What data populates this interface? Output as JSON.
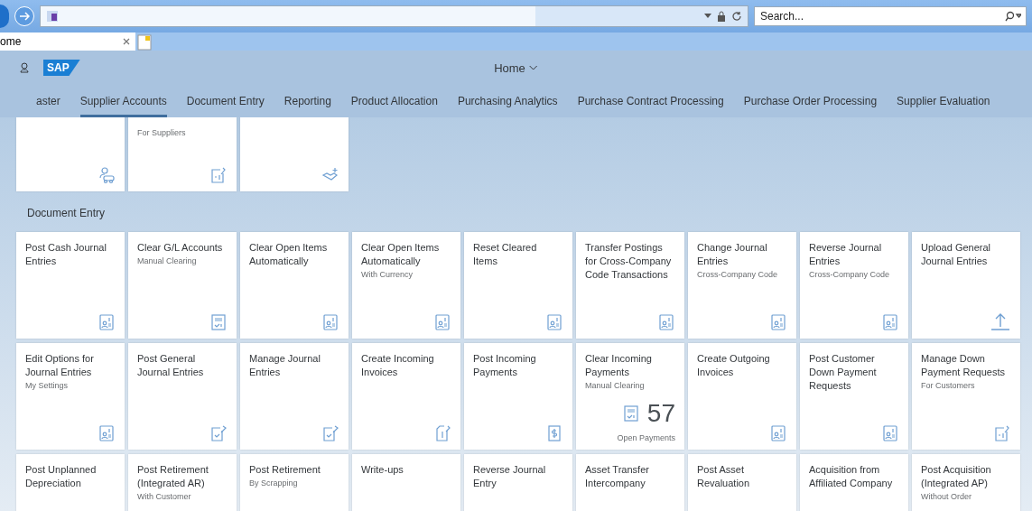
{
  "browser": {
    "search": {
      "placeholder": "Search..."
    },
    "tabs": [
      {
        "label": "ome",
        "selected": true
      }
    ]
  },
  "shell": {
    "logo": "SAP",
    "title": "Home"
  },
  "nav": [
    {
      "label": "aster",
      "selected": false
    },
    {
      "label": "Supplier Accounts",
      "selected": true
    },
    {
      "label": "Document Entry",
      "selected": false
    },
    {
      "label": "Reporting",
      "selected": false
    },
    {
      "label": "Product Allocation",
      "selected": false
    },
    {
      "label": "Purchasing Analytics",
      "selected": false
    },
    {
      "label": "Purchase Contract Processing",
      "selected": false
    },
    {
      "label": "Purchase Order Processing",
      "selected": false
    },
    {
      "label": "Supplier Evaluation",
      "selected": false
    }
  ],
  "top_tiles": [
    {
      "kind": "vehicle"
    },
    {
      "subtitle": "For Suppliers",
      "kind": "edit"
    },
    {
      "kind": "handshake"
    }
  ],
  "section": {
    "title": "Document Entry",
    "tiles": [
      {
        "title": "Post Cash Journal Entries",
        "kind": "ledger"
      },
      {
        "title": "Clear G/L Accounts",
        "subtitle": "Manual Clearing",
        "kind": "checklist"
      },
      {
        "title": "Clear Open Items Automatically",
        "kind": "ledger"
      },
      {
        "title": "Clear Open Items Automatically",
        "subtitle": "With Currency",
        "kind": "ledger"
      },
      {
        "title": "Reset Cleared Items",
        "kind": "ledger"
      },
      {
        "title": "Transfer Postings for Cross-Company Code Transactions",
        "kind": "ledger"
      },
      {
        "title": "Change Journal Entries",
        "subtitle": "Cross-Company Code",
        "kind": "ledger"
      },
      {
        "title": "Reverse Journal Entries",
        "subtitle": "Cross-Company Code",
        "kind": "ledger"
      },
      {
        "title": "Upload General Journal Entries",
        "kind": "upload"
      },
      {
        "title": "Edit Options for Journal Entries",
        "subtitle": "My Settings",
        "kind": "ledger"
      },
      {
        "title": "Post General Journal Entries",
        "kind": "checkedit"
      },
      {
        "title": "Manage Journal Entries",
        "kind": "checkedit"
      },
      {
        "title": "Create Incoming Invoices",
        "kind": "invoice"
      },
      {
        "title": "Post Incoming Payments",
        "kind": "dollar"
      },
      {
        "title": "Clear Incoming Payments",
        "subtitle": "Manual Clearing",
        "kind": "checklist",
        "number": "57",
        "footer": "Open Payments"
      },
      {
        "title": "Create Outgoing Invoices",
        "kind": "ledger"
      },
      {
        "title": "Post Customer Down Payment Requests",
        "kind": "ledger"
      },
      {
        "title": "Manage Down Payment Requests",
        "subtitle": "For Customers",
        "kind": "edit"
      },
      {
        "title": "Post Unplanned Depreciation"
      },
      {
        "title": "Post Retirement (Integrated AR)",
        "subtitle": "With Customer"
      },
      {
        "title": "Post Retirement",
        "subtitle": "By Scrapping"
      },
      {
        "title": "Write-ups"
      },
      {
        "title": "Reverse Journal Entry"
      },
      {
        "title": "Asset Transfer Intercompany"
      },
      {
        "title": "Post Asset Revaluation"
      },
      {
        "title": "Acquisition from Affiliated Company"
      },
      {
        "title": "Post Acquisition (Integrated AP)",
        "subtitle": "Without Order"
      }
    ]
  }
}
